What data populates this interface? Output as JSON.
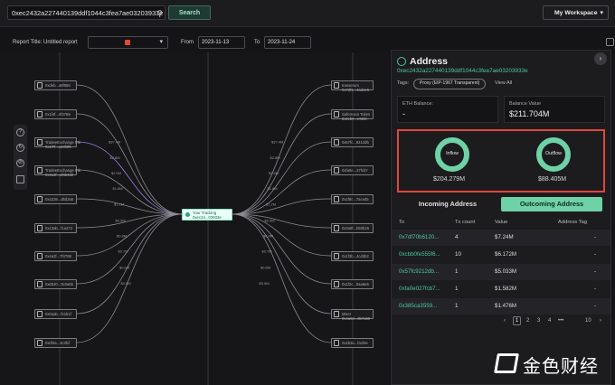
{
  "topbar": {
    "search_value": "0xec2432a227440139ddf1044c3fea7ae03203933e",
    "search_button": "Search",
    "workspace_label": "My Workspace"
  },
  "report": {
    "title_label": "Report Title: Untitled report",
    "from_label": "From",
    "from_date": "2023-11-13",
    "to_label": "To",
    "to_date": "2023-11-24"
  },
  "graph": {
    "center_label_1": "Your Tracking",
    "center_label_2": "0xec24...03933e",
    "left_nodes": [
      "0xdeb...a8f655",
      "0x1f4f...2f3788",
      "TradeeExchange Ptk\n0x1f7f...c23f4f5",
      "TradeeExchange Ptk\n0x4a1f...af4b4ab",
      "0x4239...d6d2a5",
      "0x13ab...f1a472",
      "0x4a2f...7f4788",
      "0x6520...0c0a5b",
      "0x0aab...f21b1f",
      "0x0f3a...3c3fcf"
    ],
    "right_nodes": [
      "Iranserum\n0x7df1...4ad1e6",
      "Safemoon Token\n0x5cb0...e65fd",
      "0x57fc...9212db",
      "0xfa0e...27fcb7",
      "0x1f8c...7aced5",
      "0x4a6f...b92b26",
      "0x1f3b...4cd3b2",
      "0x1f2c...0aa6e6",
      "Mixer\n0x4a8d...3b7a89",
      "0x2b3a...fa1f6e"
    ],
    "edge_labels": [
      "$37.4M",
      "$2.8M",
      "$2.5M",
      "$1.8M",
      "$1.2M",
      "$0.9M",
      "$0.8M",
      "$0.7M",
      "$0.6M",
      "$0.5M"
    ]
  },
  "panel": {
    "title": "Address",
    "address": "0xec2432a227440139ddf1044c3fea7ae03203933e",
    "tags_label": "Tags:",
    "tag": "Proxy (EIP-1967 Transparent)",
    "view_all": "View All",
    "eth_balance_label": "ETH Balance:",
    "eth_balance_value": "-",
    "balance_value_label": "Balance Value",
    "balance_value": "$211.704M",
    "inflow_label": "Inflow",
    "inflow_value": "$204.279M",
    "outflow_label": "Outflow",
    "outflow_value": "$88.405M",
    "tab_incoming": "Incoming Address",
    "tab_outgoing": "Outcoming Address",
    "columns": [
      "To",
      "Tx count",
      "Value",
      "Address Tag"
    ],
    "rows": [
      {
        "to": "0x7df70b6120...",
        "count": "4",
        "value": "$7.24M",
        "tag": "-"
      },
      {
        "to": "0xcbb0fe555f6...",
        "count": "10",
        "value": "$6.172M",
        "tag": "-"
      },
      {
        "to": "0x57fc9212db...",
        "count": "1",
        "value": "$5.033M",
        "tag": "-"
      },
      {
        "to": "0xfa0e027fcb7...",
        "count": "1",
        "value": "$1.582M",
        "tag": "-"
      },
      {
        "to": "0x385ca3559...",
        "count": "1",
        "value": "$1.476M",
        "tag": "-"
      }
    ],
    "pager": {
      "prev": "‹",
      "page1": "1",
      "page2": "2",
      "page3": "3",
      "page4": "4",
      "ellipsis": "•••",
      "last": "10",
      "next": "›"
    }
  },
  "watermark": {
    "brand": "金色财经"
  },
  "colors": {
    "accent": "#6fd2a6",
    "highlight": "#e0483a",
    "link": "#4cc89e"
  }
}
